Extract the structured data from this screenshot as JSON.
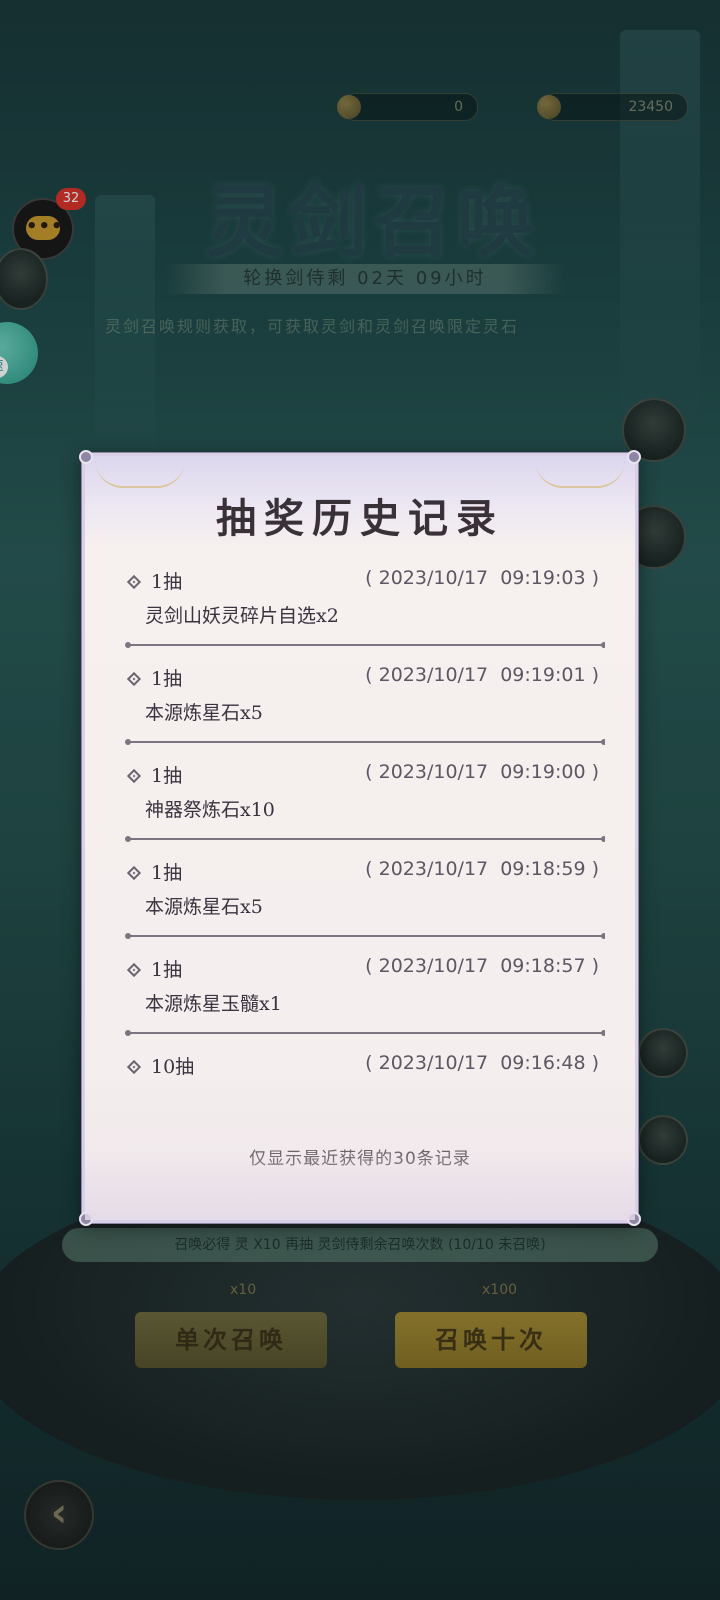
{
  "background": {
    "currency_1_value": "0",
    "currency_2_value": "23450",
    "title": "灵剑召唤",
    "countdown": "轮换剑侍剩 02天 09小时",
    "description": "灵剑召唤规则获取，可获取灵剑和灵剑召唤限定灵石",
    "banner": "召唤必得 灵 X10 再抽 灵剑侍剩余召唤次数 (10/10 未召唤)",
    "single_cost": "x10",
    "ten_cost": "x100",
    "single_button": "单次召唤",
    "ten_button": "召唤十次",
    "back_icon": "‹"
  },
  "floating": {
    "chat_badge": "32",
    "speed_label": "速"
  },
  "modal": {
    "title": "抽奖历史记录",
    "footer_note": "仅显示最近获得的30条记录",
    "records": [
      {
        "count": "1抽",
        "time": "( 2023/10/17  09:19:03 )",
        "item": "灵剑山妖灵碎片自选x2"
      },
      {
        "count": "1抽",
        "time": "( 2023/10/17  09:19:01 )",
        "item": "本源炼星石x5"
      },
      {
        "count": "1抽",
        "time": "( 2023/10/17  09:19:00 )",
        "item": "神器祭炼石x10"
      },
      {
        "count": "1抽",
        "time": "( 2023/10/17  09:18:59 )",
        "item": "本源炼星石x5"
      },
      {
        "count": "1抽",
        "time": "( 2023/10/17  09:18:57 )",
        "item": "本源炼星玉髓x1"
      },
      {
        "count": "10抽",
        "time": "( 2023/10/17  09:16:48 )",
        "item": ""
      }
    ]
  },
  "colors": {
    "modal_bg": "#f4eeee",
    "modal_border": "#d9cfe6",
    "text_primary": "#3a3340",
    "divider": "#7e7480",
    "badge": "#d8342c",
    "speed_button": "#2b9c8a"
  }
}
